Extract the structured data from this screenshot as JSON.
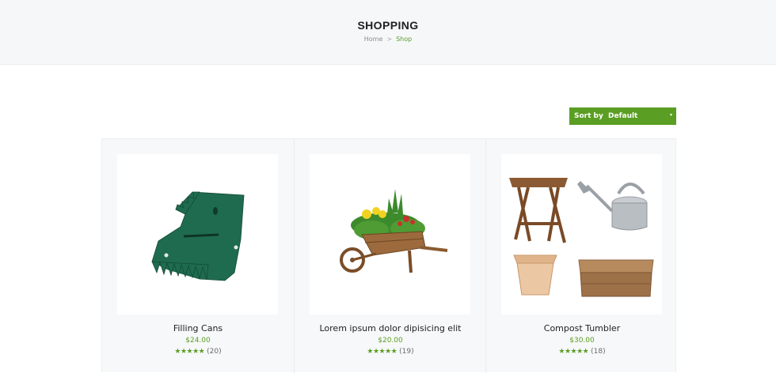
{
  "header": {
    "title": "SHOPPING",
    "breadcrumb": {
      "home": "Home",
      "separator": ">",
      "current": "Shop"
    }
  },
  "sort": {
    "label": "Sort by",
    "value": "Default",
    "caret": "▾"
  },
  "products": [
    {
      "name": "Filling Cans",
      "price": "$24.00",
      "stars": "★★★★★",
      "reviews": "(20)",
      "image": "green-leaf-grabber"
    },
    {
      "name": "Lorem ipsum dolor dipisicing elit",
      "price": "$20.00",
      "stars": "★★★★★",
      "reviews": "(19)",
      "image": "wheelbarrow-planter"
    },
    {
      "name": "Compost Tumbler",
      "price": "$30.00",
      "stars": "★★★★★",
      "reviews": "(18)",
      "image": "garden-set"
    }
  ],
  "colors": {
    "accent": "#5a9e23",
    "header_bg": "#f6f7f8",
    "grid_bg": "#f7f8f9"
  }
}
